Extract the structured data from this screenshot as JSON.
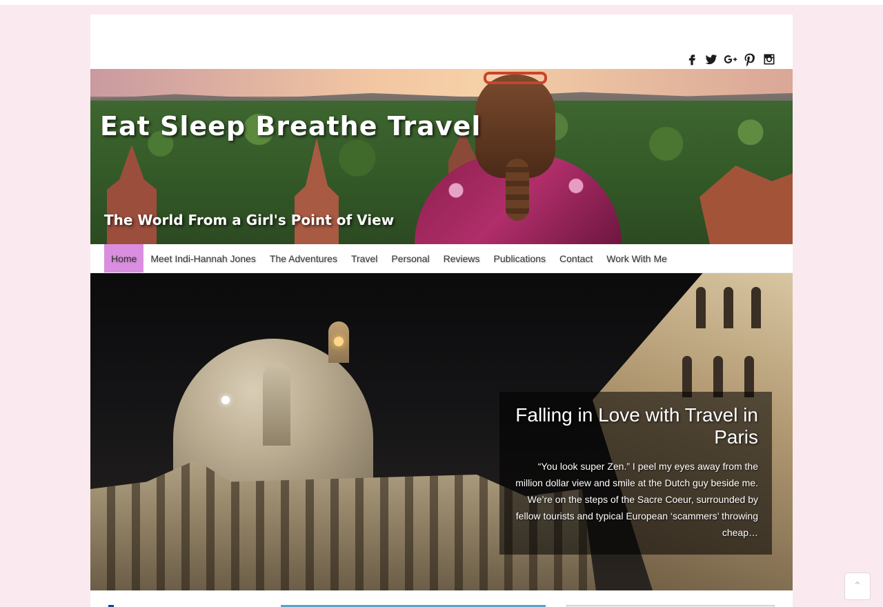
{
  "site": {
    "title": "Eat Sleep Breathe Travel",
    "tagline": "The World From a Girl's Point of View"
  },
  "social": [
    {
      "name": "facebook-icon"
    },
    {
      "name": "twitter-icon"
    },
    {
      "name": "google-plus-icon"
    },
    {
      "name": "pinterest-icon"
    },
    {
      "name": "instagram-icon"
    }
  ],
  "nav": {
    "items": [
      {
        "label": "Home",
        "active": true
      },
      {
        "label": "Meet Indi-Hannah Jones"
      },
      {
        "label": "The Adventures"
      },
      {
        "label": "Travel"
      },
      {
        "label": "Personal"
      },
      {
        "label": "Reviews"
      },
      {
        "label": "Publications"
      },
      {
        "label": "Contact"
      },
      {
        "label": "Work With Me"
      }
    ]
  },
  "slide": {
    "title": "Falling in Love with Travel in Paris",
    "excerpt": "“You look super Zen.” I peel my eyes away from the million dollar view and smile at the Dutch guy beside me. We’re on the steps of the Sacre Coeur, surrounded by fellow tourists and typical European ‘scammers’ throwing cheap…"
  },
  "colors": {
    "background": "#fbe9f0",
    "nav_active": "#da8ee0"
  },
  "back_to_top": {
    "icon": "chevron-up-icon"
  }
}
